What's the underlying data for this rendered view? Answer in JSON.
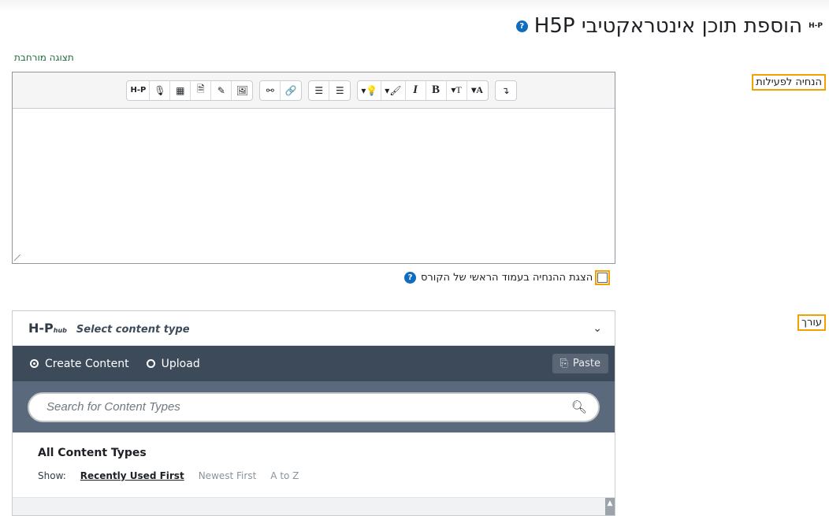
{
  "page": {
    "title": "הוספת תוכן אינטראקטיבי H5P",
    "title_icon": "h5p-icon",
    "help_icon": "?"
  },
  "activity_instructions": {
    "label": "הנחיה לפעילות",
    "expand_link": "תצוגה מורחבת",
    "toolbar": {
      "h5p": "H-P",
      "record": "🎙",
      "table": "▦",
      "media": "🗎",
      "draw": "✎",
      "image": "🖼",
      "unlink": "⚯",
      "link": "🔗",
      "ordered_list": "☰",
      "unordered_list": "☰",
      "hint": "▾💡",
      "brush": "▾🖌",
      "italic": "I",
      "bold": "B",
      "font_size": "▾T",
      "font_color": "▾A",
      "direction": "↴"
    }
  },
  "show_on_course_page": {
    "label": "הצגת ההנחיה בעמוד הראשי של הקורס",
    "checked": false
  },
  "editor": {
    "label": "עורך",
    "hub_brand": "H-P",
    "hub_brand_suffix": "hub",
    "select_content_type": "Select content type",
    "tab_create": "Create Content",
    "tab_upload": "Upload",
    "paste_label": "Paste",
    "search_placeholder": "Search for Content Types",
    "all_content_types": "All Content Types",
    "show_label": "Show:",
    "sort_recent": "Recently Used First",
    "sort_newest": "Newest First",
    "sort_az": "A to Z"
  },
  "colors": {
    "accent_outline": "#f4a000",
    "hub_dark": "#3d4a59",
    "hub_search_bg": "#5a6a7c",
    "link_green": "#1e6b3a",
    "help_blue": "#0f6cbf"
  }
}
